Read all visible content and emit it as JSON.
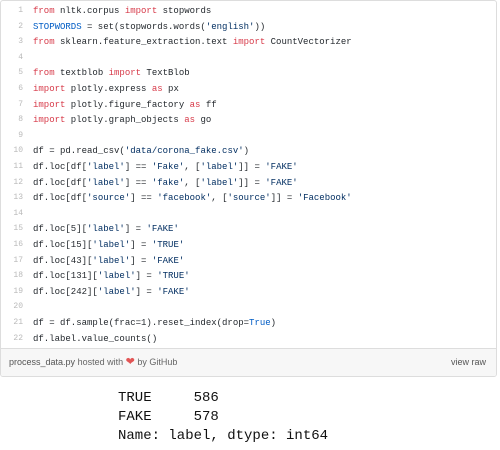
{
  "gist": {
    "lines": [
      {
        "num": "1",
        "text": "from nltk.corpus import stopwords"
      },
      {
        "num": "2",
        "text": "STOPWORDS = set(stopwords.words('english'))"
      },
      {
        "num": "3",
        "text": "from sklearn.feature_extraction.text import CountVectorizer"
      },
      {
        "num": "4",
        "text": ""
      },
      {
        "num": "5",
        "text": "from textblob import TextBlob"
      },
      {
        "num": "6",
        "text": "import plotly.express as px"
      },
      {
        "num": "7",
        "text": "import plotly.figure_factory as ff"
      },
      {
        "num": "8",
        "text": "import plotly.graph_objects as go"
      },
      {
        "num": "9",
        "text": ""
      },
      {
        "num": "10",
        "text": "df = pd.read_csv('data/corona_fake.csv')"
      },
      {
        "num": "11",
        "text": "df.loc[df['label'] == 'Fake', ['label']] = 'FAKE'"
      },
      {
        "num": "12",
        "text": "df.loc[df['label'] == 'fake', ['label']] = 'FAKE'"
      },
      {
        "num": "13",
        "text": "df.loc[df['source'] == 'facebook', ['source']] = 'Facebook'"
      },
      {
        "num": "14",
        "text": ""
      },
      {
        "num": "15",
        "text": "df.loc[5]['label'] = 'FAKE'"
      },
      {
        "num": "16",
        "text": "df.loc[15]['label'] = 'TRUE'"
      },
      {
        "num": "17",
        "text": "df.loc[43]['label'] = 'FAKE'"
      },
      {
        "num": "18",
        "text": "df.loc[131]['label'] = 'TRUE'"
      },
      {
        "num": "19",
        "text": "df.loc[242]['label'] = 'FAKE'"
      },
      {
        "num": "20",
        "text": ""
      },
      {
        "num": "21",
        "text": "df = df.sample(frac=1).reset_index(drop=True)"
      },
      {
        "num": "22",
        "text": "df.label.value_counts()"
      }
    ],
    "footer": {
      "file_name": "process_data.py",
      "hosted_with": "hosted with",
      "heart_icon": "heart-icon",
      "by": "by GitHub",
      "view_raw": "view raw"
    }
  },
  "output": {
    "lines": [
      "TRUE     586",
      "FAKE     578",
      "Name: label, dtype: int64"
    ]
  },
  "colors": {
    "keyword": "#d73a49",
    "string": "#032f62",
    "constant": "#005cc5",
    "heart": "#e25555"
  }
}
